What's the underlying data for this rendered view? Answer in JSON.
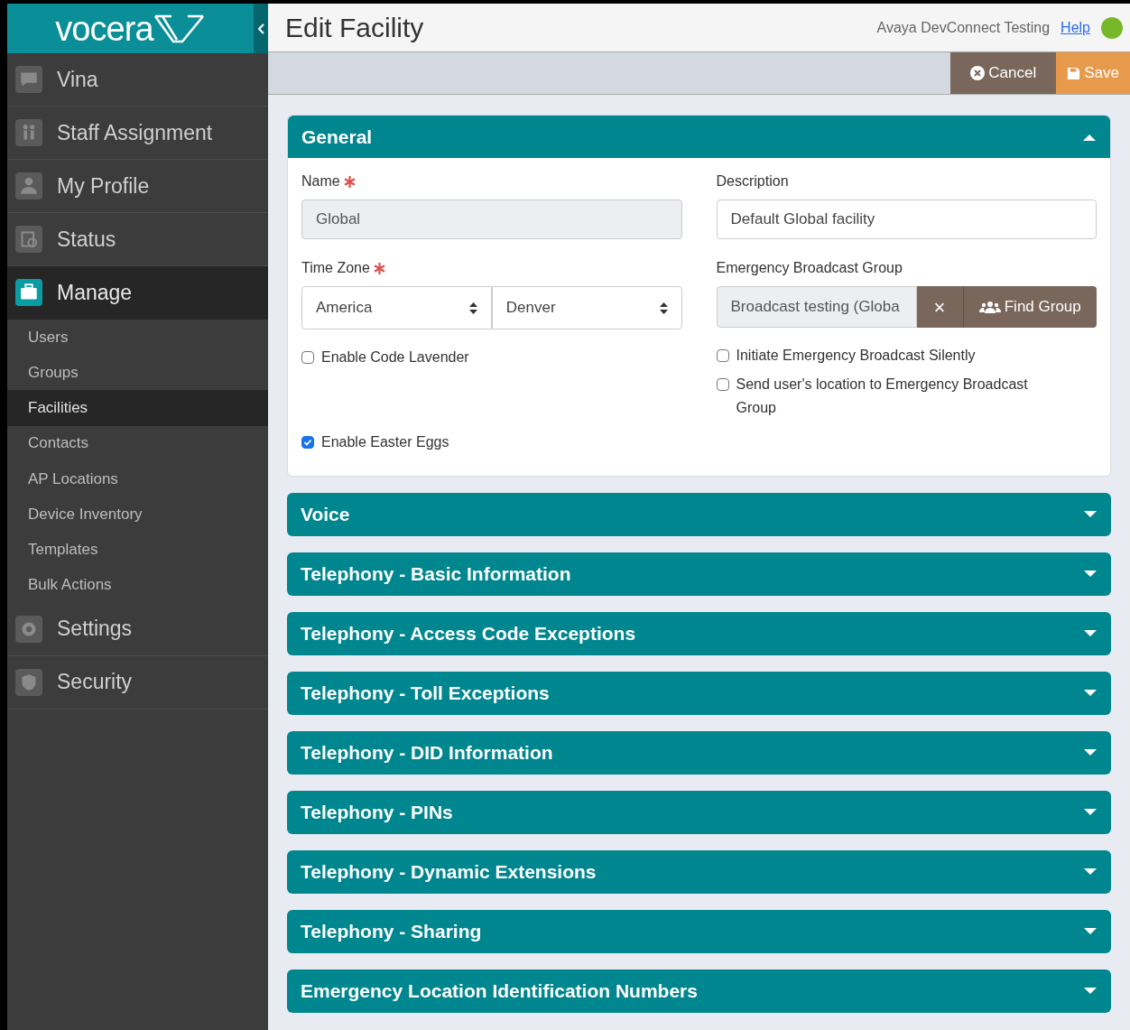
{
  "logo": {
    "text": "vocera"
  },
  "sidebar": {
    "items": [
      {
        "label": "Vina",
        "kind": "chat",
        "selected": false
      },
      {
        "label": "Staff Assignment",
        "kind": "people",
        "selected": false
      },
      {
        "label": "My Profile",
        "kind": "person",
        "selected": false
      },
      {
        "label": "Status",
        "kind": "status",
        "selected": false
      },
      {
        "label": "Manage",
        "kind": "briefcase",
        "selected": true,
        "children": [
          {
            "label": "Users",
            "selected": false
          },
          {
            "label": "Groups",
            "selected": false
          },
          {
            "label": "Facilities",
            "selected": true
          },
          {
            "label": "Contacts",
            "selected": false
          },
          {
            "label": "AP Locations",
            "selected": false
          },
          {
            "label": "Device Inventory",
            "selected": false
          },
          {
            "label": "Templates",
            "selected": false
          },
          {
            "label": "Bulk Actions",
            "selected": false
          }
        ]
      },
      {
        "label": "Settings",
        "kind": "gear",
        "selected": false
      },
      {
        "label": "Security",
        "kind": "shield",
        "selected": false
      }
    ]
  },
  "header": {
    "title": "Edit Facility",
    "user": "Avaya DevConnect Testing",
    "help_link": "Help"
  },
  "toolbar": {
    "cancel": "Cancel",
    "save": "Save"
  },
  "general": {
    "title": "General",
    "expanded": true,
    "name": {
      "label": "Name",
      "required": true,
      "value": "Global",
      "disabled": true
    },
    "description": {
      "label": "Description",
      "required": false,
      "value": "Default Global facility"
    },
    "time_zone": {
      "label": "Time Zone",
      "required": true,
      "region": "America",
      "city": "Denver"
    },
    "broadcast_group": {
      "label": "Emergency Broadcast Group",
      "required": false,
      "value": "Broadcast testing (Globa",
      "clear": "×",
      "find": "Find Group"
    },
    "left_checks": [
      {
        "label": "Enable Code Lavender",
        "checked": false
      },
      {
        "label": "Enable Easter Eggs",
        "checked": true
      }
    ],
    "right_checks": [
      {
        "label": "Initiate Emergency Broadcast Silently",
        "checked": false
      },
      {
        "label": "Send user's location to Emergency Broadcast Group",
        "checked": false
      }
    ]
  },
  "sections": [
    {
      "title": "Voice",
      "expanded": false
    },
    {
      "title": "Telephony - Basic Information",
      "expanded": false
    },
    {
      "title": "Telephony - Access Code Exceptions",
      "expanded": false
    },
    {
      "title": "Telephony - Toll Exceptions",
      "expanded": false
    },
    {
      "title": "Telephony - DID Information",
      "expanded": false
    },
    {
      "title": "Telephony - PINs",
      "expanded": false
    },
    {
      "title": "Telephony - Dynamic Extensions",
      "expanded": false
    },
    {
      "title": "Telephony - Sharing",
      "expanded": false
    },
    {
      "title": "Emergency Location Identification Numbers",
      "expanded": false
    }
  ]
}
